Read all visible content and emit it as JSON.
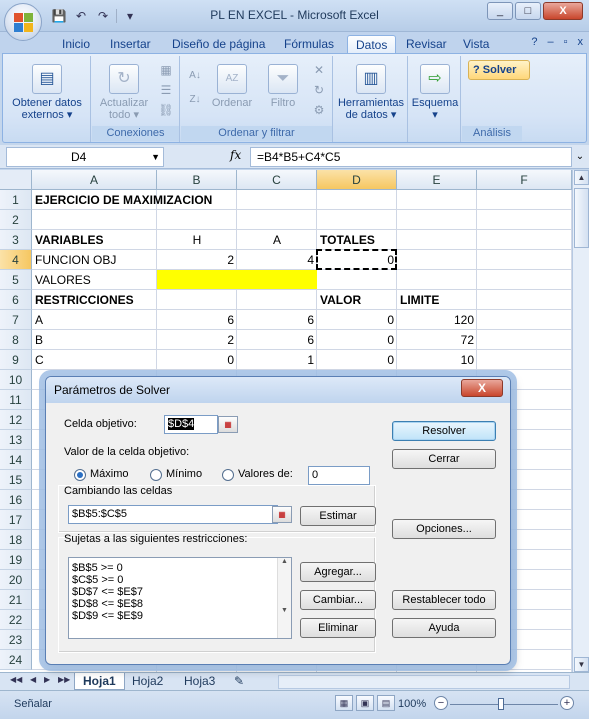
{
  "window": {
    "title": "PL EN EXCEL - Microsoft Excel",
    "minimize": "_",
    "maximize": "□",
    "close": "X"
  },
  "qat": {
    "save": "💾",
    "undo": "↶",
    "redo": "↷",
    "customize": "▾"
  },
  "tabs": [
    "Inicio",
    "Insertar",
    "Diseño de página",
    "Fórmulas",
    "Datos",
    "Revisar",
    "Vista"
  ],
  "active_tab": "Datos",
  "tab_right": {
    "help": "?",
    "minimize": "–",
    "restore": "▫",
    "close": "x"
  },
  "ribbon": {
    "groups": [
      {
        "label": "",
        "buttons": [
          {
            "label1": "Obtener datos",
            "label2": "externos ▾"
          }
        ]
      },
      {
        "label": "Conexiones",
        "buttons": [
          {
            "label1": "Actualizar",
            "label2": "todo ▾"
          }
        ]
      },
      {
        "label": "Ordenar y filtrar",
        "buttons": [
          {
            "label": "Ordenar"
          },
          {
            "label": "Filtro"
          }
        ]
      },
      {
        "label": "",
        "buttons": [
          {
            "label1": "Herramientas",
            "label2": "de datos ▾"
          }
        ]
      },
      {
        "label": "",
        "buttons": [
          {
            "label1": "Esquema",
            "label2": "▾"
          }
        ]
      },
      {
        "label": "Análisis",
        "buttons": [
          {
            "label": "Solver"
          }
        ]
      }
    ]
  },
  "formula_bar": {
    "name_box": "D4",
    "fx": "fx",
    "formula": "=B4*B5+C4*C5"
  },
  "columns": [
    "A",
    "B",
    "C",
    "D",
    "E",
    "F"
  ],
  "selected_column": "D",
  "rows": [
    "1",
    "2",
    "3",
    "4",
    "5",
    "6",
    "7",
    "8",
    "9",
    "10",
    "11",
    "12",
    "13",
    "14",
    "15",
    "16",
    "17",
    "18",
    "19",
    "20",
    "21",
    "22",
    "23",
    "24"
  ],
  "selected_row": "4",
  "cells": {
    "A1": "EJERCICIO DE MAXIMIZACION",
    "A3": "VARIABLES",
    "B3": "H",
    "C3": "A",
    "D3": "TOTALES",
    "A4": "FUNCION OBJ",
    "B4": "2",
    "C4": "4",
    "D4": "0",
    "A5": "VALORES",
    "A6": "RESTRICCIONES",
    "D6": "VALOR",
    "E6": "LIMITE",
    "A7": "A",
    "B7": "6",
    "C7": "6",
    "D7": "0",
    "E7": "120",
    "A8": "B",
    "B8": "2",
    "C8": "6",
    "D8": "0",
    "E8": "72",
    "A9": "C",
    "B9": "0",
    "C9": "1",
    "D9": "0",
    "E9": "10"
  },
  "highlight_color": "#ffff00",
  "sheets": [
    "Hoja1",
    "Hoja2",
    "Hoja3"
  ],
  "active_sheet": "Hoja1",
  "status": {
    "mode": "Señalar",
    "zoom": "100%"
  },
  "solver": {
    "title": "Parámetros de Solver",
    "close": "X",
    "target_label": "Celda objetivo:",
    "target_value": "$D$4",
    "value_label": "Valor de la celda objetivo:",
    "options": [
      "Máximo",
      "Mínimo",
      "Valores de:"
    ],
    "selected_option": "Máximo",
    "values_of": "0",
    "changing_label": "Cambiando las celdas",
    "changing_value": "$B$5:$C$5",
    "estimate": "Estimar",
    "constraints_label": "Sujetas a las siguientes restricciones:",
    "constraints": [
      "$B$5 >= 0",
      "$C$5 >= 0",
      "$D$7 <= $E$7",
      "$D$8 <= $E$8",
      "$D$9 <= $E$9"
    ],
    "add": "Agregar...",
    "change": "Cambiar...",
    "delete": "Eliminar",
    "solve": "Resolver",
    "cancel": "Cerrar",
    "options_btn": "Opciones...",
    "reset": "Restablecer todo",
    "help": "Ayuda"
  }
}
